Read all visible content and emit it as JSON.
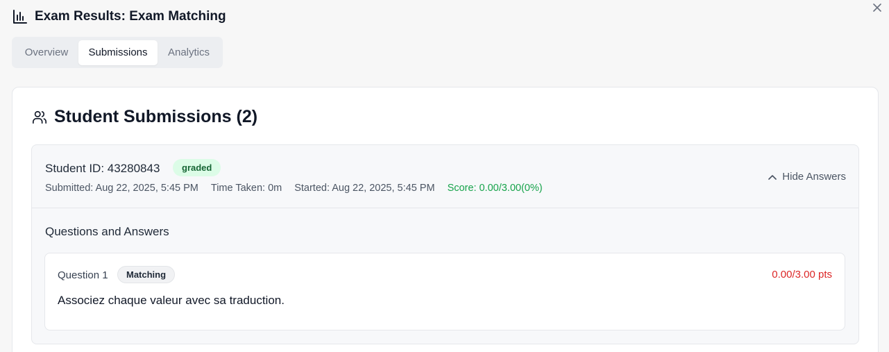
{
  "header": {
    "icon": "bar-chart-icon",
    "title": "Exam Results: Exam Matching"
  },
  "close": {
    "icon": "close-icon"
  },
  "tabs": [
    {
      "label": "Overview",
      "active": false
    },
    {
      "label": "Submissions",
      "active": true
    },
    {
      "label": "Analytics",
      "active": false
    }
  ],
  "submissions_card": {
    "icon": "users-icon",
    "title": "Student Submissions (2)"
  },
  "submission": {
    "student_id": "Student ID: 43280843",
    "status": "graded",
    "submitted": "Submitted: Aug 22, 2025, 5:45 PM",
    "time_taken": "Time Taken: 0m",
    "started": "Started: Aug 22, 2025, 5:45 PM",
    "score": "Score: 0.00/3.00(0%)",
    "toggle_label": "Hide Answers",
    "toggle_icon": "chevron-up-icon",
    "qa_title": "Questions and Answers",
    "questions": [
      {
        "number": "Question 1",
        "type": "Matching",
        "points": "0.00/3.00 pts",
        "text": "Associez chaque valeur avec sa traduction."
      }
    ]
  },
  "colors": {
    "graded_bg": "#dcfce7",
    "graded_text": "#166534",
    "score_green": "#16a34a",
    "points_red": "#dc2626"
  }
}
